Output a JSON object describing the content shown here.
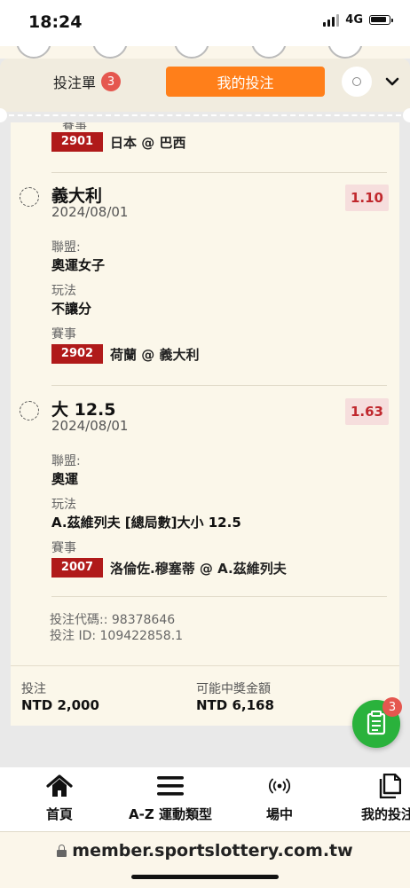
{
  "status": {
    "time": "18:24",
    "network": "4G"
  },
  "header": {
    "betslip_label": "投注單",
    "betslip_count": "3",
    "mybets_label": "我的投注"
  },
  "slip": {
    "top_event": {
      "code": "2901",
      "name": "日本 @ 巴西"
    },
    "selections": [
      {
        "name": "義大利",
        "date": "2024/08/01",
        "odds": "1.10",
        "league_label": "聯盟:",
        "league": "奧運女子",
        "market_label": "玩法",
        "market": "不讓分",
        "event_label": "賽事",
        "event_code": "2902",
        "event_name": "荷蘭 @ 義大利"
      },
      {
        "name": "大 12.5",
        "date": "2024/08/01",
        "odds": "1.63",
        "league_label": "聯盟:",
        "league": "奧運",
        "market_label": "玩法",
        "market": "A.茲維列夫 [總局數]大小 12.5",
        "event_label": "賽事",
        "event_code": "2007",
        "event_name": "洛倫佐.穆塞蒂 @ A.茲維列夫"
      }
    ],
    "bet_code": "投注代碼:: 98378646",
    "bet_id": "投注 ID: 109422858.1"
  },
  "totals": {
    "stake_label": "投注",
    "stake_value": "NTD 2,000",
    "payout_label": "可能中獎金額",
    "payout_value": "NTD 6,168"
  },
  "fab": {
    "badge": "3",
    "icon": "clipboard-icon"
  },
  "bottom_nav": {
    "items": [
      {
        "label": "首頁",
        "icon": "home-icon"
      },
      {
        "label": "A-Z 運動類型",
        "icon": "menu-icon"
      },
      {
        "label": "場中",
        "icon": "live-icon"
      },
      {
        "label": "我的投注",
        "icon": "copy-icon"
      }
    ]
  },
  "browser": {
    "url": "member.sportslottery.com.tw"
  },
  "colors": {
    "accent": "#ff7f1a",
    "event_code_bg": "#b01a1a",
    "odds_text": "#c0282d",
    "fab": "#2ab23c",
    "badge": "#e5574f"
  }
}
